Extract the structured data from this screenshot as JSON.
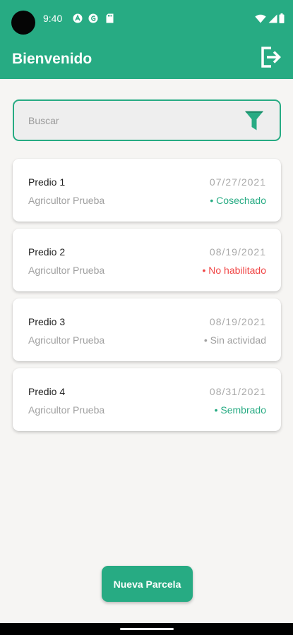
{
  "status_bar": {
    "time": "9:40",
    "icons": [
      "app-a-icon",
      "app-b-icon",
      "sd-card-icon",
      "wifi-icon",
      "cell-signal-icon",
      "battery-icon"
    ]
  },
  "appbar": {
    "title": "Bienvenido",
    "logout_icon": "logout-icon"
  },
  "search": {
    "placeholder": "Buscar",
    "value": "",
    "filter_icon": "filter-icon"
  },
  "parcels": [
    {
      "name": "Predio 1",
      "farmer": "Agricultor Prueba",
      "date": "07/27/2021",
      "status": "• Cosechado",
      "status_color": "#27ab83"
    },
    {
      "name": "Predio 2",
      "farmer": "Agricultor Prueba",
      "date": "08/19/2021",
      "status": "• No habilitado",
      "status_color": "#f04444"
    },
    {
      "name": "Predio 3",
      "farmer": "Agricultor Prueba",
      "date": "08/19/2021",
      "status": "• Sin actividad",
      "status_color": "#a0a0a0"
    },
    {
      "name": "Predio 4",
      "farmer": "Agricultor Prueba",
      "date": "08/31/2021",
      "status": "• Sembrado",
      "status_color": "#27ab83"
    }
  ],
  "fab": {
    "label": "Nueva Parcela"
  },
  "colors": {
    "primary": "#27ab83",
    "background": "#f6f5f3",
    "danger": "#f04444",
    "muted": "#a0a0a0"
  }
}
